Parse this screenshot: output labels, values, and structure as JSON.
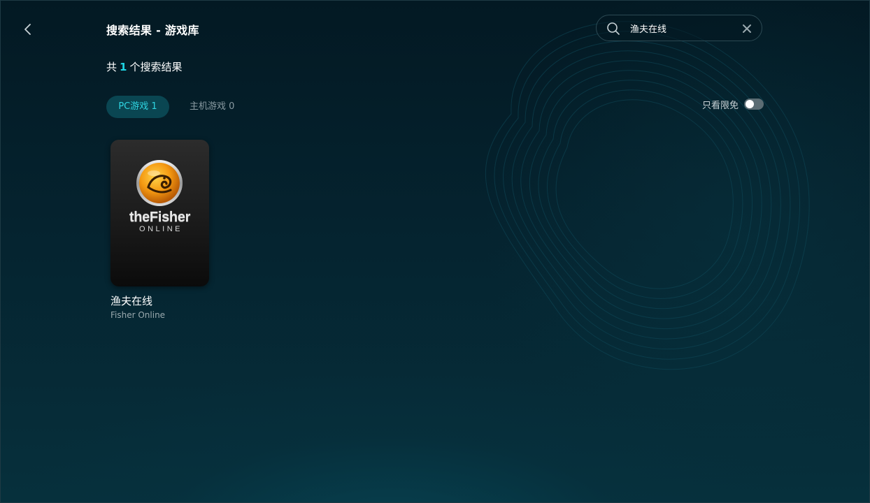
{
  "header": {
    "back_icon": "chevron-left-icon",
    "title": "搜索结果 - 游戏库"
  },
  "search": {
    "icon": "search-icon",
    "value": "渔夫在线",
    "clear_icon": "close-icon"
  },
  "results": {
    "prefix": "共",
    "count": "1",
    "suffix": "个搜索结果"
  },
  "tabs": [
    {
      "label": "PC游戏 1",
      "active": true
    },
    {
      "label": "主机游戏 0",
      "active": false
    }
  ],
  "filter": {
    "label": "只看限免",
    "enabled": false
  },
  "games": [
    {
      "cover_logo_title": "theFisher",
      "cover_logo_subtitle": "ONLINE",
      "name": "渔夫在线",
      "subname": "Fisher Online"
    }
  ],
  "colors": {
    "accent": "#1fd6e6",
    "tab_active_bg": "#0a4652",
    "background": "#05232f",
    "toggle_off": "#5b6c73"
  }
}
